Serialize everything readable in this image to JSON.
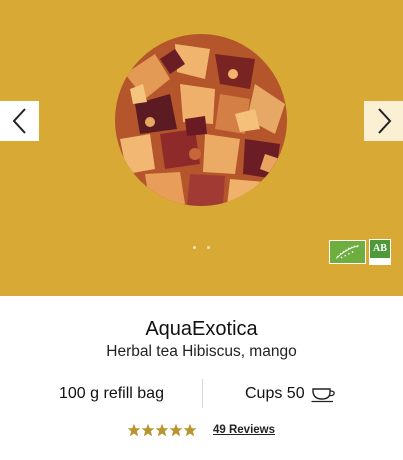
{
  "product": {
    "name": "AquaExotica",
    "description": "Herbal tea Hibiscus, mango",
    "package": "100 g refill bag",
    "cups_label": "Cups 50"
  },
  "rating": {
    "stars": 5,
    "reviews_label": "49 Reviews"
  },
  "carousel": {
    "slide_count": 2,
    "current_slide": 1,
    "icons": {
      "prev": "chevron-left-icon",
      "next": "chevron-right-icon"
    }
  },
  "badges": {
    "eu_organic": "eu-organic-leaf-logo",
    "ab_text": "AB"
  },
  "colors": {
    "hero_background": "#d8a935",
    "star_color": "#b7962f",
    "organic_green": "#6dae3f"
  }
}
